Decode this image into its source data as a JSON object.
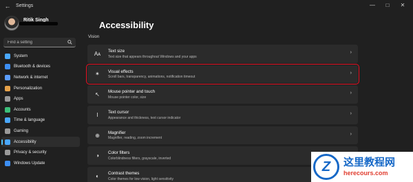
{
  "window": {
    "title": "Settings"
  },
  "profile": {
    "name": "Ritik Singh"
  },
  "search": {
    "placeholder": "Find a setting"
  },
  "sidebar": {
    "items": [
      {
        "label": "System",
        "icon": "monitor-icon",
        "color": "#4aa8ff"
      },
      {
        "label": "Bluetooth & devices",
        "icon": "bluetooth-icon",
        "color": "#3d8ff5"
      },
      {
        "label": "Network & internet",
        "icon": "wifi-icon",
        "color": "#5b9dff"
      },
      {
        "label": "Personalization",
        "icon": "paintbrush-icon",
        "color": "#e6a24a"
      },
      {
        "label": "Apps",
        "icon": "apps-icon",
        "color": "#9a9a9a"
      },
      {
        "label": "Accounts",
        "icon": "person-icon",
        "color": "#3cbf7a"
      },
      {
        "label": "Time & language",
        "icon": "globe-clock-icon",
        "color": "#4aa8ff"
      },
      {
        "label": "Gaming",
        "icon": "gamepad-icon",
        "color": "#9a9a9a"
      },
      {
        "label": "Accessibility",
        "icon": "accessibility-icon",
        "color": "#4aa8ff",
        "active": true
      },
      {
        "label": "Privacy & security",
        "icon": "shield-icon",
        "color": "#9a9a9a"
      },
      {
        "label": "Windows Update",
        "icon": "update-icon",
        "color": "#3d8ff5"
      }
    ]
  },
  "main": {
    "title": "Accessibility",
    "section": "Vision",
    "cards": [
      {
        "title": "Text size",
        "subtitle": "Text size that appears throughout Windows and your apps",
        "icon": "text-size-icon"
      },
      {
        "title": "Visual effects",
        "subtitle": "Scroll bars, transparency, animations, notification timeout",
        "icon": "sparkle-icon",
        "highlighted": true
      },
      {
        "title": "Mouse pointer and touch",
        "subtitle": "Mouse pointer color, size",
        "icon": "mouse-pointer-icon"
      },
      {
        "title": "Text cursor",
        "subtitle": "Appearance and thickness, text cursor indicator",
        "icon": "text-cursor-icon"
      },
      {
        "title": "Magnifier",
        "subtitle": "Magnifier, reading, zoom increment",
        "icon": "magnifier-icon"
      },
      {
        "title": "Color filters",
        "subtitle": "Colorblindness filters, grayscale, inverted",
        "icon": "color-filter-icon"
      },
      {
        "title": "Contrast themes",
        "subtitle": "Color themes for low vision, light sensitivity",
        "icon": "contrast-icon"
      }
    ]
  },
  "watermark": {
    "cn": "这里教程网",
    "url": "herecours.com",
    "logo": "Z"
  },
  "colors": {
    "accent": "#4cc2ff",
    "highlight_border": "#e81123",
    "background": "#202020",
    "card": "#2b2b2b"
  }
}
